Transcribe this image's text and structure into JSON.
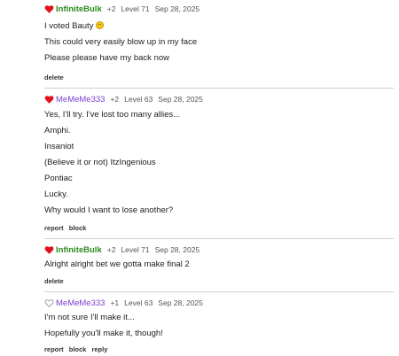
{
  "comments": [
    {
      "heart": "filled",
      "username": "InfiniteBulk",
      "username_color": "#2d8a1f",
      "votes": "+2",
      "level": "Level 71",
      "date": "Sep 28, 2025",
      "lines": [
        "I voted Bauty",
        "This could very easily blow up in my face",
        "Please please have my back now"
      ],
      "emoji": "flushed-face-emoji",
      "actions": {
        "delete": "delete"
      }
    },
    {
      "heart": "filled",
      "username": "MeMeMe333",
      "username_color": "#7b3fd1",
      "votes": "+2",
      "level": "Level 63",
      "date": "Sep 28, 2025",
      "lines": [
        "Yes, I'll try. I've lost too many allies...",
        "Amphi.",
        "Insaniot",
        "(Believe it or not) ItzIngenious",
        "Pontiac",
        "Lucky.",
        "Why would I want to lose another?"
      ],
      "actions": {
        "report": "report",
        "block": "block"
      }
    },
    {
      "heart": "filled",
      "username": "InfiniteBulk",
      "username_color": "#2d8a1f",
      "votes": "+2",
      "level": "Level 71",
      "date": "Sep 28, 2025",
      "lines": [
        "Alright alright bet we gotta make final 2"
      ],
      "actions": {
        "delete": "delete"
      }
    },
    {
      "heart": "outline",
      "username": "MeMeMe333",
      "username_color": "#7b3fd1",
      "votes": "+1",
      "level": "Level 63",
      "date": "Sep 28, 2025",
      "lines": [
        "I'm not sure I'll make it...",
        "Hopefully you'll make it, though!"
      ],
      "actions": {
        "report": "report",
        "block": "block",
        "reply": "reply"
      }
    }
  ],
  "colors": {
    "heart_red": "#e0121b",
    "heart_outline": "#8a8aa0",
    "divider": "#d0d0d0"
  }
}
